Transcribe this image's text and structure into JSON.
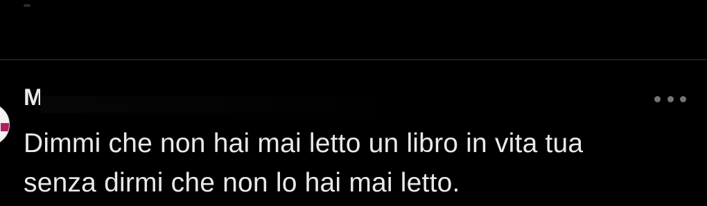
{
  "post": {
    "author_name": "Ma",
    "text": "Dimmi che non hai mai letto un libro in vita tua\nsenza dirmi che non lo hai mai letto."
  },
  "icons": {
    "more": "more-options-icon",
    "avatar": "avatar-image"
  },
  "colors": {
    "background": "#000000",
    "text": "#e7e9ea",
    "secondary": "#71767b",
    "divider": "#2f3336"
  }
}
